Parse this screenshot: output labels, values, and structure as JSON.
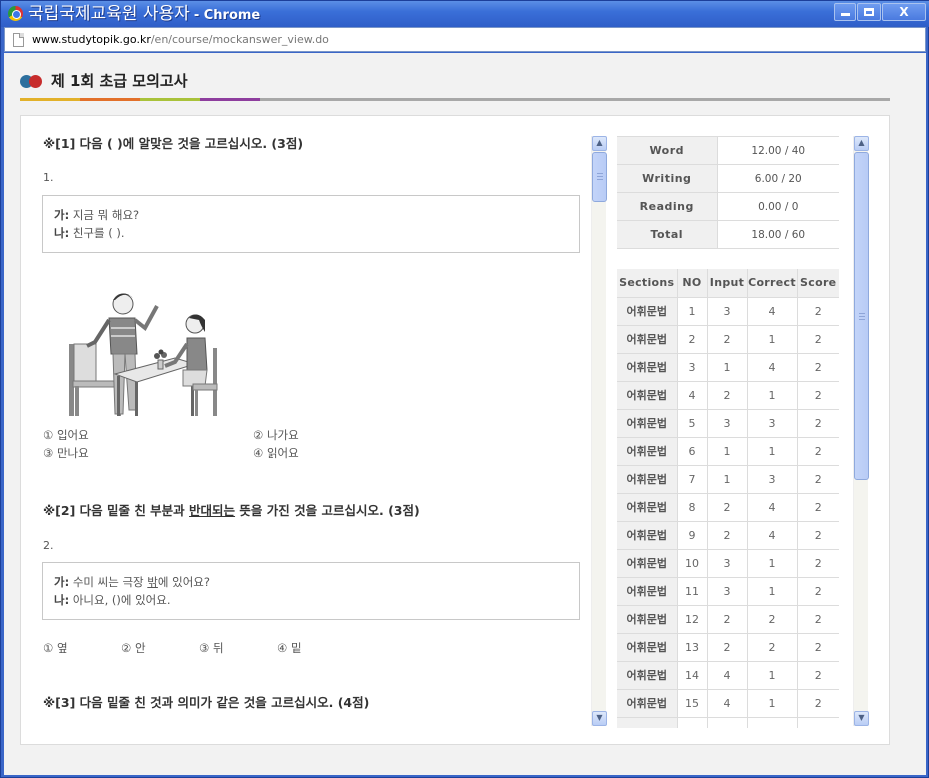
{
  "window": {
    "title": "국립국제교육원 사용자",
    "title_suffix": "- Chrome",
    "controls": {
      "minimize": "minimize",
      "maximize": "maximize",
      "close": "X"
    }
  },
  "address": {
    "domain": "www.studytopik.go.kr",
    "path": "/en/course/mockanswer_view.do"
  },
  "page": {
    "title": "제 1회 초급 모의고사",
    "rule_colors": [
      "#e2b12a",
      "#e2702a",
      "#a9c23a",
      "#8e3e9e",
      "#a8a8a8"
    ]
  },
  "questions": [
    {
      "header": "※[1] 다음 ( )에 알맞은 것을 고르십시오. (3점)",
      "number": "1.",
      "dialog": [
        {
          "speaker": "가:",
          "text": "지금 뭐 해요?"
        },
        {
          "speaker": "나:",
          "text": "친구를 ( )."
        }
      ],
      "image": "illustration-man-waving-woman-seated-at-table",
      "choices": [
        "① 입어요",
        "② 나가요",
        "③ 만나요",
        "④ 읽어요"
      ]
    },
    {
      "header_pre": "※[2] 다음 밑줄 친 부분과 ",
      "header_underlined": "반대되는",
      "header_post": " 뜻을 가진 것을 고르십시오. (3점)",
      "number": "2.",
      "dialog": [
        {
          "speaker": "가:",
          "text_pre": "수미 씨는 극장 ",
          "text_underlined": "밖",
          "text_post": "에 있어요?"
        },
        {
          "speaker": "나:",
          "text": "아니요, ()에 있어요."
        }
      ],
      "choices": [
        "① 옆",
        "② 안",
        "③ 뒤",
        "④ 밑"
      ]
    },
    {
      "header": "※[3] 다음 밑줄 친 것과 의미가 같은 것을 고르십시오. (4점)"
    }
  ],
  "summary": [
    {
      "label": "Word",
      "value": "12.00 / 40"
    },
    {
      "label": "Writing",
      "value": "6.00 / 20"
    },
    {
      "label": "Reading",
      "value": "0.00 / 0"
    },
    {
      "label": "Total",
      "value": "18.00 / 60"
    }
  ],
  "detail": {
    "headers": [
      "Sections",
      "NO",
      "Input",
      "Correct",
      "Score"
    ],
    "rows": [
      [
        "어휘문법",
        "1",
        "3",
        "4",
        "2"
      ],
      [
        "어휘문법",
        "2",
        "2",
        "1",
        "2"
      ],
      [
        "어휘문법",
        "3",
        "1",
        "4",
        "2"
      ],
      [
        "어휘문법",
        "4",
        "2",
        "1",
        "2"
      ],
      [
        "어휘문법",
        "5",
        "3",
        "3",
        "2"
      ],
      [
        "어휘문법",
        "6",
        "1",
        "1",
        "2"
      ],
      [
        "어휘문법",
        "7",
        "1",
        "3",
        "2"
      ],
      [
        "어휘문법",
        "8",
        "2",
        "4",
        "2"
      ],
      [
        "어휘문법",
        "9",
        "2",
        "4",
        "2"
      ],
      [
        "어휘문법",
        "10",
        "3",
        "1",
        "2"
      ],
      [
        "어휘문법",
        "11",
        "3",
        "1",
        "2"
      ],
      [
        "어휘문법",
        "12",
        "2",
        "2",
        "2"
      ],
      [
        "어휘문법",
        "13",
        "2",
        "2",
        "2"
      ],
      [
        "어휘문법",
        "14",
        "4",
        "1",
        "2"
      ],
      [
        "어휘문법",
        "15",
        "4",
        "1",
        "2"
      ],
      [
        "",
        "",
        "",
        "",
        ""
      ]
    ]
  }
}
